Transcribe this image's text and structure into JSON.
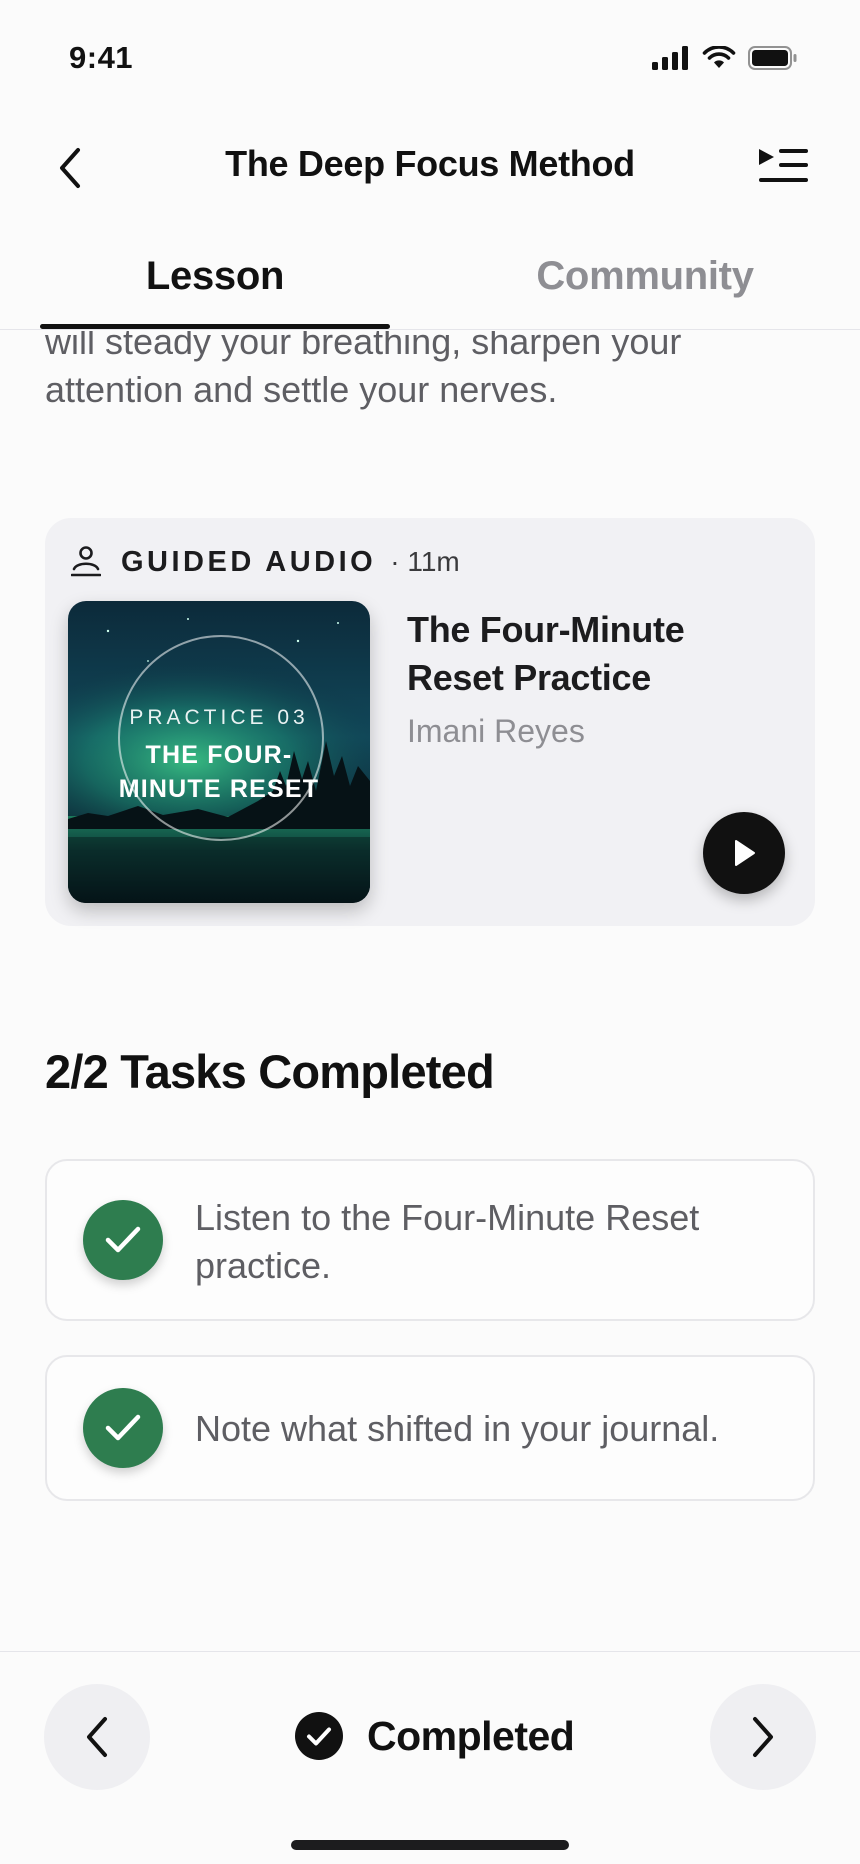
{
  "status_bar": {
    "time": "9:41"
  },
  "header": {
    "title": "The Deep Focus Method"
  },
  "tabs": [
    {
      "label": "Lesson",
      "active": true
    },
    {
      "label": "Community",
      "active": false
    }
  ],
  "intro": {
    "text": "will steady your breathing, sharpen your attention and settle your nerves."
  },
  "audio_card": {
    "kicker": "GUIDED AUDIO",
    "duration": "· 11m",
    "artwork": {
      "kicker": "PRACTICE 03",
      "title_line1": "THE FOUR-",
      "title_line2": "MINUTE RESET"
    },
    "title": "The Four-Minute Reset Practice",
    "author": "Imani Reyes"
  },
  "tasks": {
    "heading": "2/2 Tasks Completed",
    "items": [
      {
        "text": "Listen to the Four-Minute Reset practice.",
        "done": true
      },
      {
        "text": "Note what shifted in your journal.",
        "done": true
      }
    ]
  },
  "bottom_bar": {
    "status_label": "Completed"
  },
  "colors": {
    "accent_green": "#2e7d4f",
    "primary": "#111111",
    "muted": "#8e8e93"
  }
}
